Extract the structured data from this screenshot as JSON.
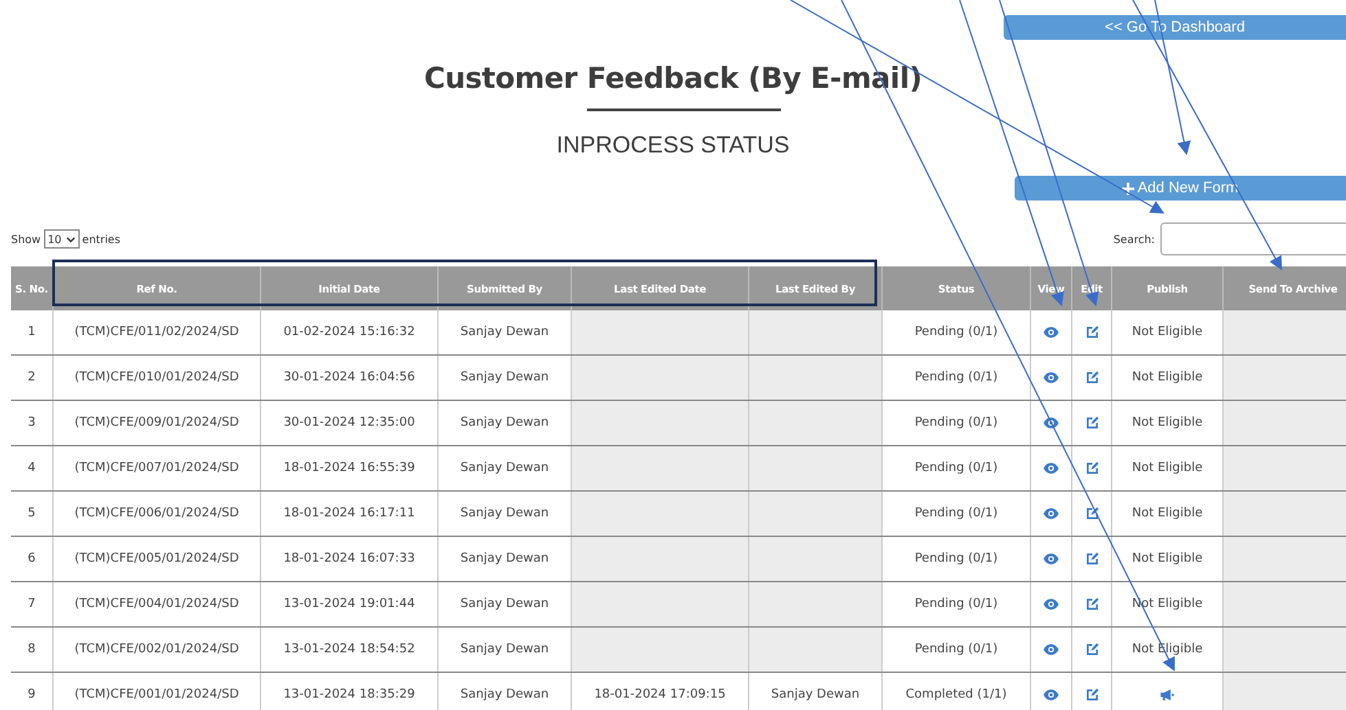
{
  "buttons": {
    "dashboard": "<< Go To Dashboard",
    "add_new": "Add New Form"
  },
  "title": "Customer Feedback (By E-mail)",
  "subtitle": "INPROCESS STATUS",
  "length": {
    "label_before": "Show",
    "value": "10",
    "label_after": "entries"
  },
  "search": {
    "label": "Search:"
  },
  "table": {
    "columns": [
      "S. No.",
      "Ref No.",
      "Initial Date",
      "Submitted By",
      "Last Edited Date",
      "Last Edited By",
      "Status",
      "View",
      "Edit",
      "Publish",
      "Send To Archive"
    ],
    "rows": [
      {
        "sno": "1",
        "ref": "(TCM)CFE/011/02/2024/SD",
        "initial_date": "01-02-2024 15:16:32",
        "submitted_by": "Sanjay Dewan",
        "status": "Pending (0/1)",
        "publish": {
          "kind": "text",
          "text": "Not Eligible"
        }
      },
      {
        "sno": "2",
        "ref": "(TCM)CFE/010/01/2024/SD",
        "initial_date": "30-01-2024 16:04:56",
        "submitted_by": "Sanjay Dewan",
        "status": "Pending (0/1)",
        "publish": {
          "kind": "text",
          "text": "Not Eligible"
        }
      },
      {
        "sno": "3",
        "ref": "(TCM)CFE/009/01/2024/SD",
        "initial_date": "30-01-2024 12:35:00",
        "submitted_by": "Sanjay Dewan",
        "status": "Pending (0/1)",
        "publish": {
          "kind": "text",
          "text": "Not Eligible"
        }
      },
      {
        "sno": "4",
        "ref": "(TCM)CFE/007/01/2024/SD",
        "initial_date": "18-01-2024 16:55:39",
        "submitted_by": "Sanjay Dewan",
        "status": "Pending (0/1)",
        "publish": {
          "kind": "text",
          "text": "Not Eligible"
        }
      },
      {
        "sno": "5",
        "ref": "(TCM)CFE/006/01/2024/SD",
        "initial_date": "18-01-2024 16:17:11",
        "submitted_by": "Sanjay Dewan",
        "status": "Pending (0/1)",
        "publish": {
          "kind": "text",
          "text": "Not Eligible"
        }
      },
      {
        "sno": "6",
        "ref": "(TCM)CFE/005/01/2024/SD",
        "initial_date": "18-01-2024 16:07:33",
        "submitted_by": "Sanjay Dewan",
        "status": "Pending (0/1)",
        "publish": {
          "kind": "text",
          "text": "Not Eligible"
        }
      },
      {
        "sno": "7",
        "ref": "(TCM)CFE/004/01/2024/SD",
        "initial_date": "13-01-2024 19:01:44",
        "submitted_by": "Sanjay Dewan",
        "status": "Pending (0/1)",
        "publish": {
          "kind": "text",
          "text": "Not Eligible"
        }
      },
      {
        "sno": "8",
        "ref": "(TCM)CFE/002/01/2024/SD",
        "initial_date": "13-01-2024 18:54:52",
        "submitted_by": "Sanjay Dewan",
        "status": "Pending (0/1)",
        "publish": {
          "kind": "text",
          "text": "Not Eligible"
        }
      },
      {
        "sno": "9",
        "ref": "(TCM)CFE/001/01/2024/SD",
        "initial_date": "13-01-2024 18:35:29",
        "submitted_by": "Sanjay Dewan",
        "last_edited_date": "18-01-2024 17:09:15",
        "last_edited_by": "Sanjay Dewan",
        "status": "Completed (1/1)",
        "publish": {
          "kind": "icon"
        }
      }
    ]
  }
}
